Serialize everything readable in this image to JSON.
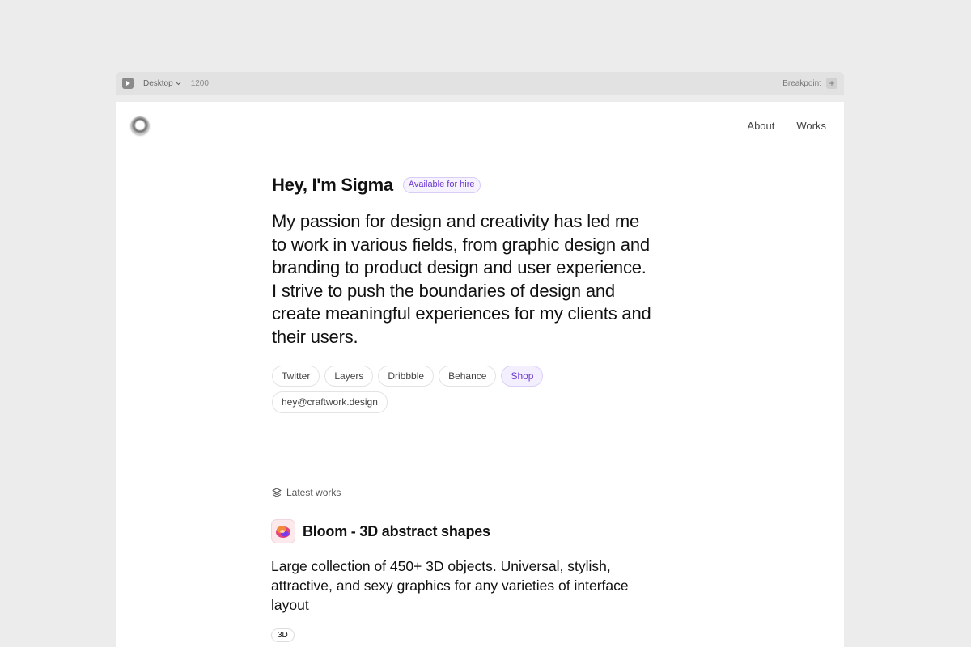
{
  "toolbar": {
    "device_label": "Desktop",
    "width_value": "1200",
    "breakpoint_label": "Breakpoint",
    "add_label": "+"
  },
  "nav": {
    "items": [
      {
        "label": "About"
      },
      {
        "label": "Works"
      }
    ]
  },
  "hero": {
    "title": "Hey, I'm Sigma",
    "badge": "Available for hire",
    "text": "My passion for design and creativity has led me to work in various fields, from graphic design and branding to product design and user experience. I strive to push the boundaries of design and create meaningful experiences for my clients and their users."
  },
  "links": [
    {
      "label": "Twitter"
    },
    {
      "label": "Layers"
    },
    {
      "label": "Dribbble"
    },
    {
      "label": "Behance"
    },
    {
      "label": "Shop"
    },
    {
      "label": "hey@craftwork.design"
    }
  ],
  "works": {
    "section_label": "Latest works",
    "items": [
      {
        "title": "Bloom - 3D abstract shapes",
        "description": "Large collection of 450+ 3D objects. Universal, stylish, attractive, and sexy graphics for any varieties of interface layout",
        "tag": "3D"
      }
    ]
  },
  "colors": {
    "accent": "#6b3bd1",
    "accent_bg": "#f4efff",
    "page_bg": "#ececec"
  },
  "icons": {
    "play": "play-icon",
    "device_chevron": "chevron-down-icon",
    "breakpoint_add": "plus-icon",
    "section": "layers-icon",
    "work_thumb": "bloom-shape-icon"
  }
}
